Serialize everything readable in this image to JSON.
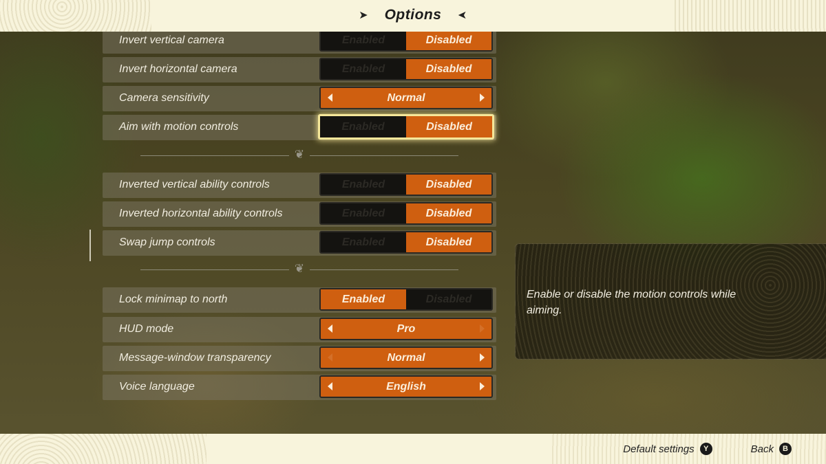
{
  "header": {
    "title": "Options"
  },
  "groups": [
    {
      "rows": [
        {
          "label": "Invert vertical camera",
          "type": "toggle",
          "options": [
            "Enabled",
            "Disabled"
          ],
          "value": "Disabled"
        },
        {
          "label": "Invert horizontal camera",
          "type": "toggle",
          "options": [
            "Enabled",
            "Disabled"
          ],
          "value": "Disabled"
        },
        {
          "label": "Camera sensitivity",
          "type": "selector",
          "value": "Normal",
          "left_arrow": true,
          "right_arrow": true
        },
        {
          "label": "Aim with motion controls",
          "type": "toggle",
          "options": [
            "Enabled",
            "Disabled"
          ],
          "value": "Disabled",
          "focused": true
        }
      ]
    },
    {
      "rows": [
        {
          "label": "Inverted vertical ability controls",
          "type": "toggle",
          "options": [
            "Enabled",
            "Disabled"
          ],
          "value": "Disabled"
        },
        {
          "label": "Inverted horizontal ability controls",
          "type": "toggle",
          "options": [
            "Enabled",
            "Disabled"
          ],
          "value": "Disabled"
        },
        {
          "label": "Swap jump controls",
          "type": "toggle",
          "options": [
            "Enabled",
            "Disabled"
          ],
          "value": "Disabled"
        }
      ]
    },
    {
      "rows": [
        {
          "label": "Lock minimap to north",
          "type": "toggle",
          "options": [
            "Enabled",
            "Disabled"
          ],
          "value": "Enabled"
        },
        {
          "label": "HUD mode",
          "type": "selector",
          "value": "Pro",
          "left_arrow": true,
          "right_arrow": false
        },
        {
          "label": "Message-window transparency",
          "type": "selector",
          "value": "Normal",
          "left_arrow": false,
          "right_arrow": true
        },
        {
          "label": "Voice language",
          "type": "selector",
          "value": "English",
          "left_arrow": true,
          "right_arrow": true
        }
      ]
    }
  ],
  "description": "Enable or disable the motion controls while aiming.",
  "footer": {
    "default_settings": "Default settings",
    "default_button": "Y",
    "back": "Back",
    "back_button": "B"
  },
  "colors": {
    "accent": "#cf5f10",
    "focus": "#f5e79a",
    "banner": "#f8f4dc"
  }
}
